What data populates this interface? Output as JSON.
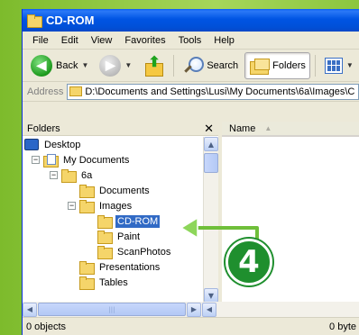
{
  "window": {
    "title": "CD-ROM"
  },
  "menu": {
    "items": [
      "File",
      "Edit",
      "View",
      "Favorites",
      "Tools",
      "Help"
    ]
  },
  "toolbar": {
    "back_label": "Back",
    "search_label": "Search",
    "folders_label": "Folders"
  },
  "address": {
    "label": "Address",
    "value": "D:\\Documents and Settings\\Lusi\\My Documents\\6a\\Images\\C"
  },
  "folders_pane": {
    "title": "Folders",
    "tree": [
      {
        "label": "Desktop"
      },
      {
        "label": "My Documents"
      },
      {
        "label": "6a"
      },
      {
        "label": "Documents"
      },
      {
        "label": "Images"
      },
      {
        "label": "CD-ROM"
      },
      {
        "label": "Paint"
      },
      {
        "label": "ScanPhotos"
      },
      {
        "label": "Presentations"
      },
      {
        "label": "Tables"
      }
    ]
  },
  "content_pane": {
    "column_name": "Name"
  },
  "status": {
    "left": "0 objects",
    "right": "0 byte"
  },
  "callout": {
    "step": "4"
  },
  "colors": {
    "accent": "#316ac5",
    "badge": "#1f8f2e",
    "background": "#8cc63f"
  }
}
